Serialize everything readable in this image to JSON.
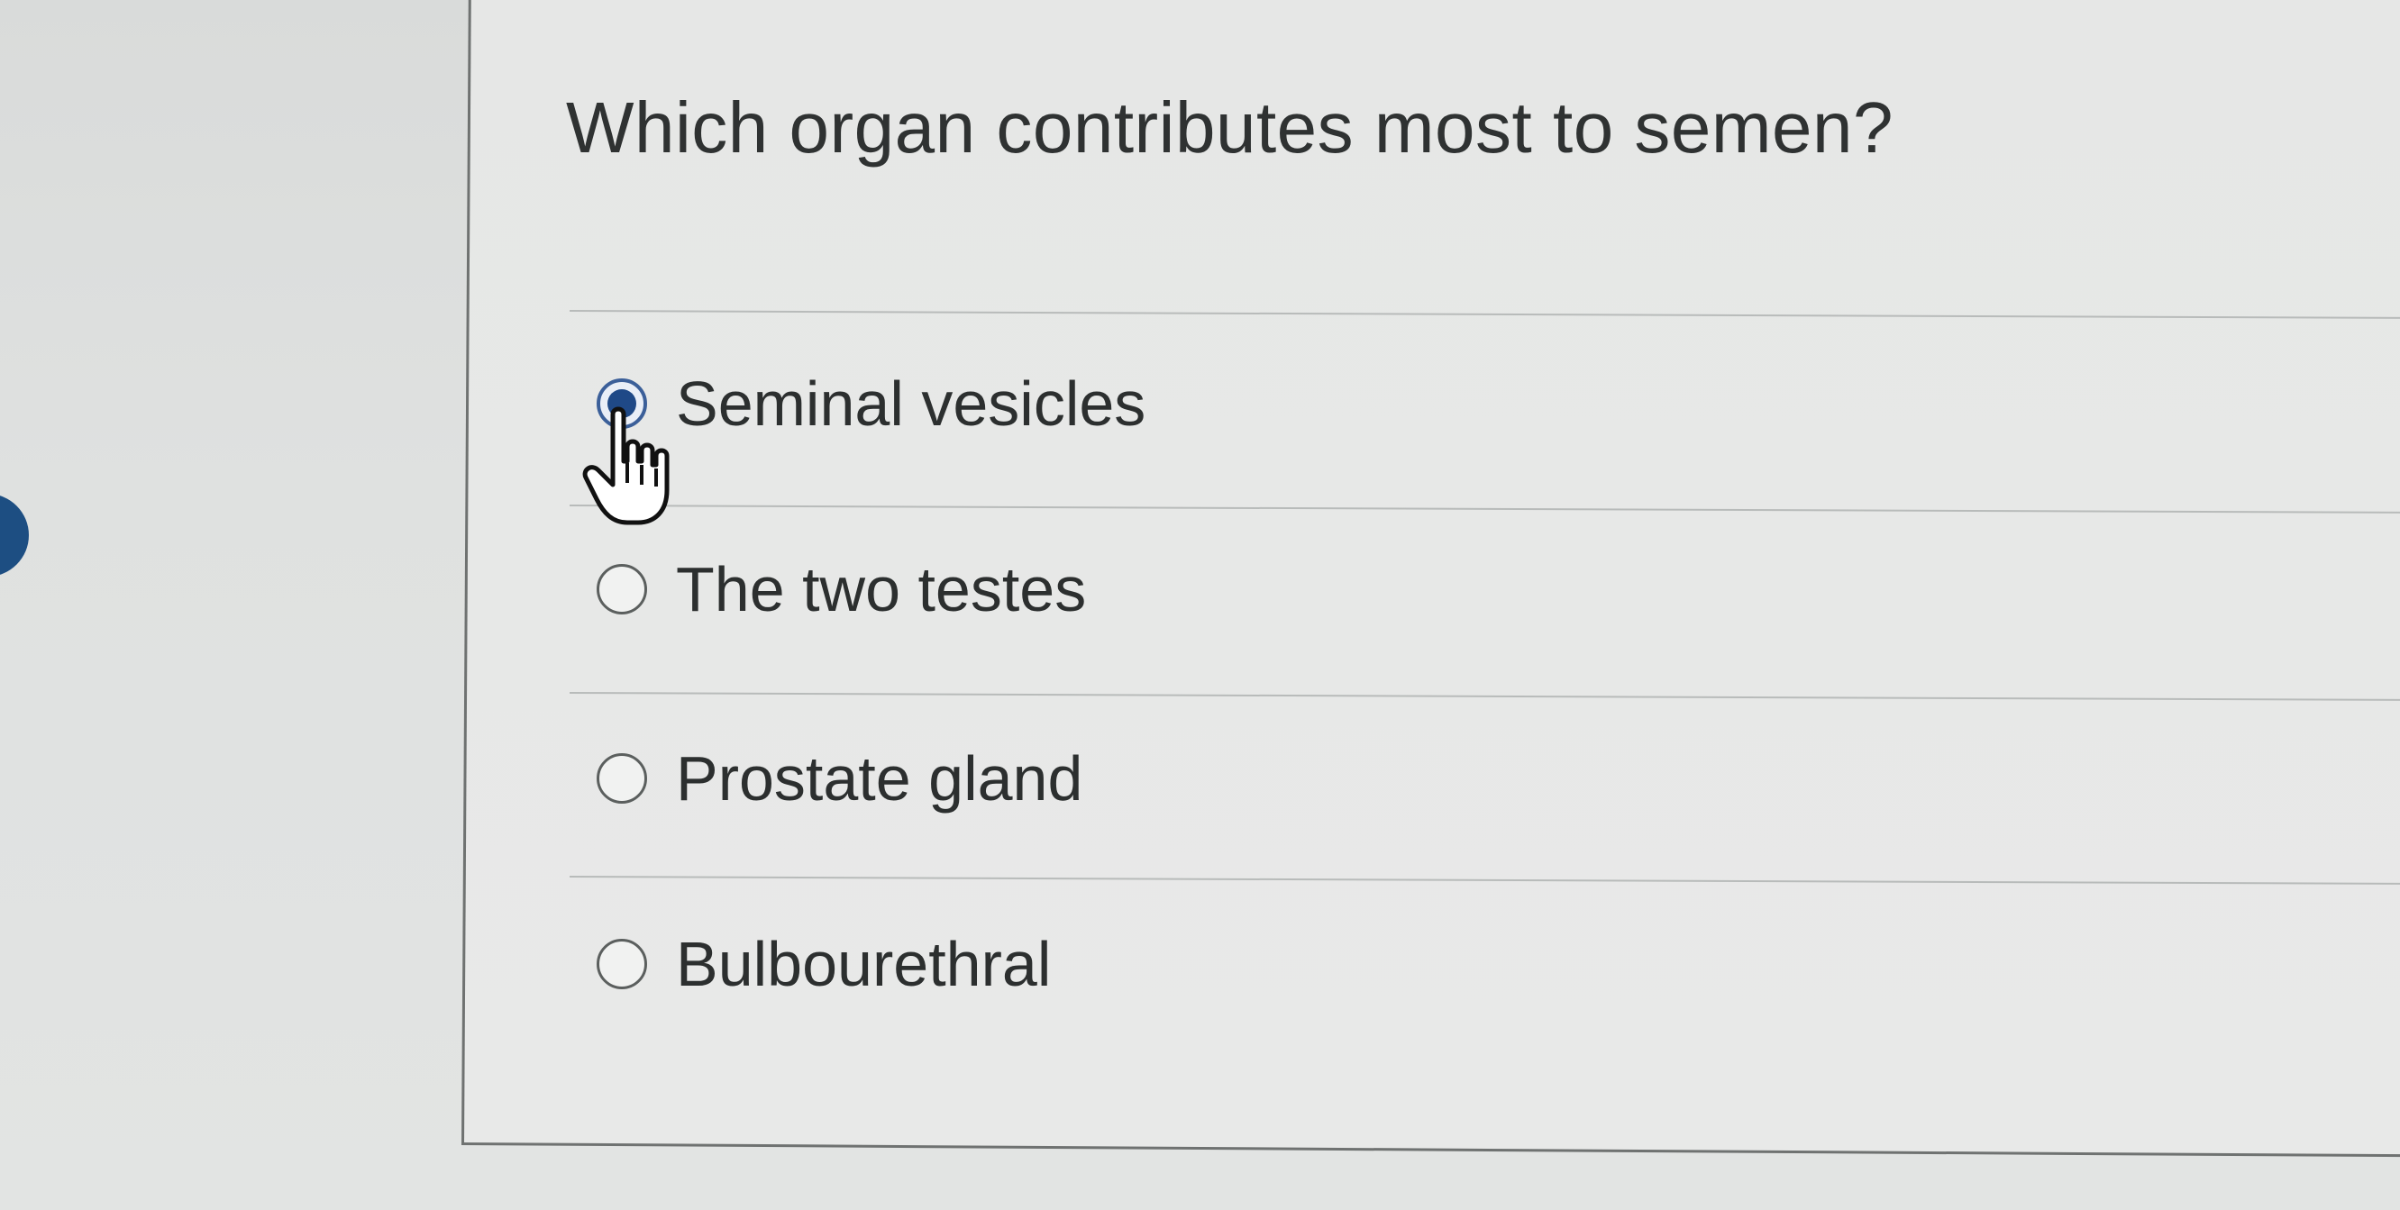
{
  "question": {
    "text": "Which organ contributes most to semen?"
  },
  "options": [
    {
      "label": "Seminal vesicles",
      "selected": true
    },
    {
      "label": "The two testes",
      "selected": false
    },
    {
      "label": "Prostate gland",
      "selected": false
    },
    {
      "label": "Bulbourethral",
      "selected": false
    }
  ],
  "colors": {
    "selected_radio": "#1f4987",
    "side_marker": "#1d4e82",
    "text": "#2c2f2f"
  },
  "cursor": {
    "icon": "hand-pointer-icon"
  }
}
